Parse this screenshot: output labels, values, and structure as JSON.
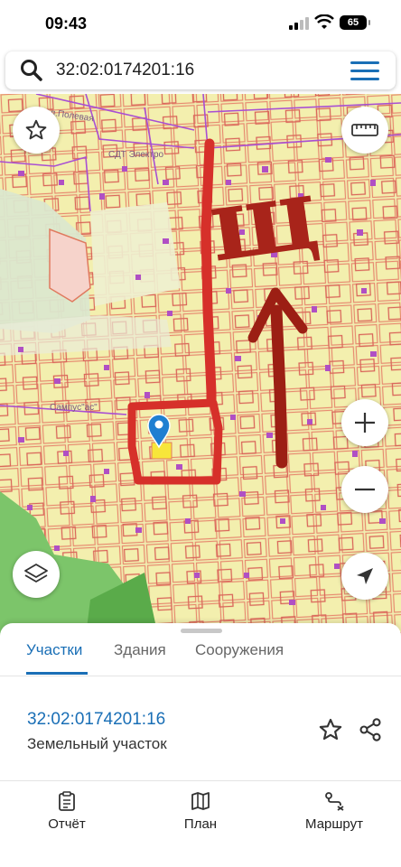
{
  "status_bar": {
    "time": "09:43",
    "battery": "65"
  },
  "search": {
    "value": "32:02:0174201:16"
  },
  "map": {
    "labels": [
      "Кол.Полевая",
      "СДТ Электро",
      "С‍ампус\"ас\""
    ],
    "handwriting": "щ"
  },
  "bottom_sheet": {
    "tabs": [
      {
        "label": "Участки",
        "active": true
      },
      {
        "label": "Здания",
        "active": false
      },
      {
        "label": "Сооружения",
        "active": false
      }
    ],
    "result": {
      "cadastral_number": "32:02:0174201:16",
      "type": "Земельный участок"
    }
  },
  "bottom_nav": [
    {
      "label": "Отчёт",
      "icon": "report-icon"
    },
    {
      "label": "План",
      "icon": "map-icon"
    },
    {
      "label": "Маршрут",
      "icon": "route-icon"
    }
  ],
  "colors": {
    "accent": "#1a6fb6",
    "parcel_fill": "#f1eeb0",
    "parcel_border": "#e07a5f",
    "building": "#b04fc4",
    "marker": "#1f7fd1",
    "annotation": "#d6302a",
    "annotation_dark": "#9c1f14"
  }
}
